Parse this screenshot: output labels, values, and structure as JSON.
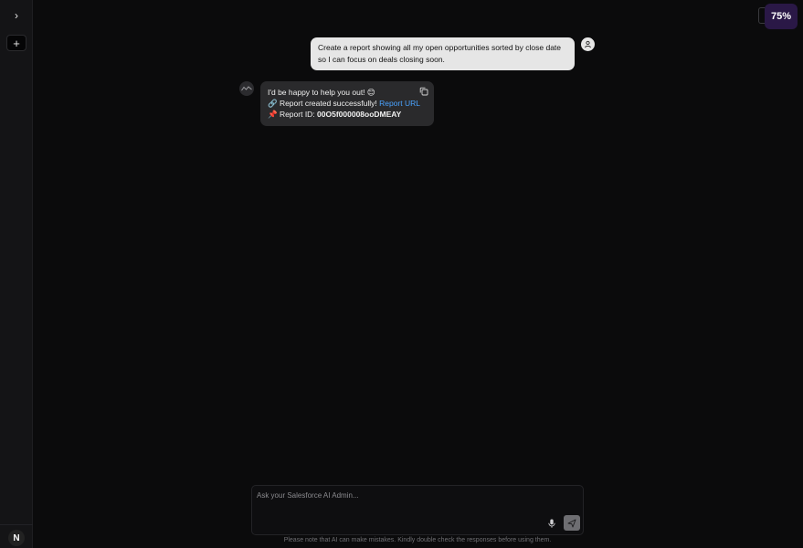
{
  "sidebar": {
    "expand_label": "›",
    "new_chat_label": "+",
    "user_initial": "N"
  },
  "zoom": {
    "level": "75%"
  },
  "messages": {
    "user": {
      "text": "Create a report showing all my open opportunities sorted by close date so I can focus on deals closing soon."
    },
    "assistant": {
      "line1": "I'd be happy to help you out! 😊",
      "line2_prefix": "🔗 Report created successfully! ",
      "link_label": "Report URL",
      "line3_prefix": "📌 Report ID: ",
      "report_id": "00O5f000008ooDMEAY"
    }
  },
  "composer": {
    "placeholder": "Ask your Salesforce AI Admin...",
    "value": ""
  },
  "footer": {
    "disclaimer": "Please note that AI can make mistakes. Kindly double check the responses before using them."
  },
  "icons": {
    "expand": "chevron-right-icon",
    "new_chat": "plus-icon",
    "user": "user-icon",
    "bot": "wave-icon",
    "copy": "copy-icon",
    "mic": "microphone-icon",
    "send": "send-icon"
  }
}
